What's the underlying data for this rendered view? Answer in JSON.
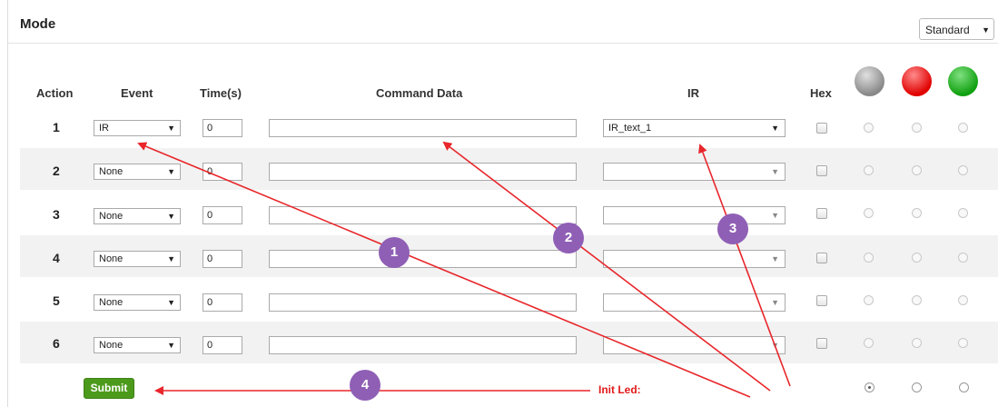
{
  "header": {
    "title": "Mode",
    "mode_value": "Standard"
  },
  "columns": {
    "action": "Action",
    "event": "Event",
    "time": "Time(s)",
    "command": "Command Data",
    "ir": "IR",
    "hex": "Hex"
  },
  "rows": [
    {
      "num": "1",
      "event": "IR",
      "time": "0",
      "command": "",
      "ir": "IR_text_1"
    },
    {
      "num": "2",
      "event": "None",
      "time": "0",
      "command": "",
      "ir": ""
    },
    {
      "num": "3",
      "event": "None",
      "time": "0",
      "command": "",
      "ir": ""
    },
    {
      "num": "4",
      "event": "None",
      "time": "0",
      "command": "",
      "ir": ""
    },
    {
      "num": "5",
      "event": "None",
      "time": "0",
      "command": "",
      "ir": ""
    },
    {
      "num": "6",
      "event": "None",
      "time": "0",
      "command": "",
      "ir": ""
    }
  ],
  "led_colors": [
    "#888888",
    "#e00000",
    "#10a010"
  ],
  "footer": {
    "submit_label": "Submit",
    "init_led_label": "Init Led:"
  },
  "annotations": [
    "1",
    "2",
    "3",
    "4"
  ],
  "annotation_color": "#e8262b",
  "badge_color": "#8f5fb5"
}
